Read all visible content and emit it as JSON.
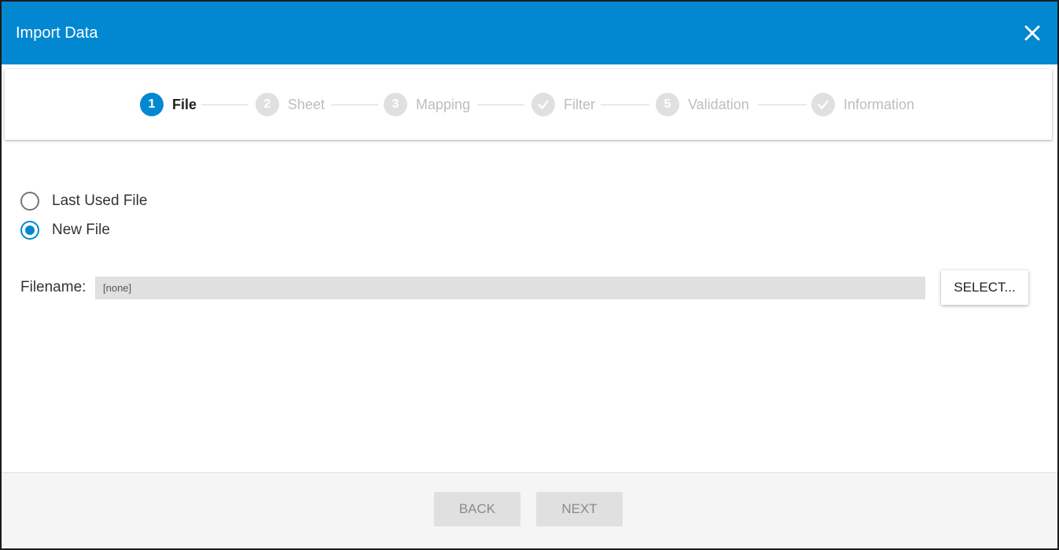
{
  "dialog": {
    "title": "Import Data",
    "close_icon": "close-icon"
  },
  "stepper": {
    "steps": [
      {
        "marker": "1",
        "label": "File",
        "state": "active"
      },
      {
        "marker": "2",
        "label": "Sheet",
        "state": "inactive"
      },
      {
        "marker": "3",
        "label": "Mapping",
        "state": "inactive"
      },
      {
        "marker": "check-icon",
        "label": "Filter",
        "state": "inactive"
      },
      {
        "marker": "5",
        "label": "Validation",
        "state": "inactive"
      },
      {
        "marker": "check-icon",
        "label": "Information",
        "state": "inactive"
      }
    ]
  },
  "file_source": {
    "options": [
      {
        "label": "Last Used File",
        "checked": false
      },
      {
        "label": "New File",
        "checked": true
      }
    ]
  },
  "filename": {
    "label": "Filename:",
    "value": "[none]",
    "select_label": "SELECT..."
  },
  "footer": {
    "back_label": "BACK",
    "next_label": "NEXT"
  },
  "colors": {
    "accent": "#0288d1",
    "inactive_step": "#e0e0e0",
    "footer_bg": "#f5f5f5"
  }
}
